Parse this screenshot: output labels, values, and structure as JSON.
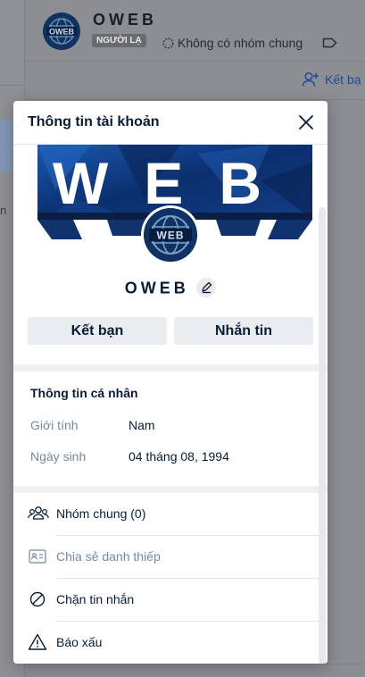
{
  "background": {
    "contact_name": "OWEB",
    "stranger_badge": "NGƯỜI LẠ",
    "mutual_groups_status": "Không có nhóm chung",
    "add_friend_label": "Kết bạ",
    "left_fragment": "n"
  },
  "modal": {
    "title": "Thông tin tài khoản",
    "cover_text": "WEB",
    "avatar_text": "WEB",
    "profile_name": "OWEB",
    "add_friend_button": "Kết bạn",
    "message_button": "Nhắn tin",
    "personal_info": {
      "title": "Thông tin cá nhân",
      "gender_label": "Giới tính",
      "gender_value": "Nam",
      "birthday_label": "Ngày sinh",
      "birthday_value": "04 tháng 08, 1994"
    },
    "menu": [
      {
        "label": "Nhóm chung (0)",
        "icon": "users-icon",
        "muted": false
      },
      {
        "label": "Chia sẻ danh thiếp",
        "icon": "contact-card-icon",
        "muted": true
      },
      {
        "label": "Chặn tin nhắn",
        "icon": "block-icon",
        "muted": false
      },
      {
        "label": "Báo xấu",
        "icon": "warning-icon",
        "muted": false
      }
    ]
  },
  "colors": {
    "overlay": "#8a8c8f",
    "text_primary": "#081c36",
    "text_secondary": "#7589a3",
    "button_bg": "#eaedf0",
    "brand_navy": "#0b2f6e",
    "link_blue": "#1d4c9c"
  }
}
